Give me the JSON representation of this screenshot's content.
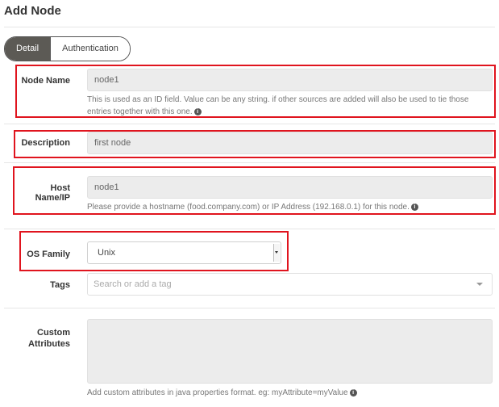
{
  "page": {
    "title": "Add Node"
  },
  "tabs": [
    {
      "label": "Detail",
      "active": true
    },
    {
      "label": "Authentication",
      "active": false
    }
  ],
  "fields": {
    "node_name": {
      "label": "Node Name",
      "value": "node1",
      "help": "This is used as an ID field. Value can be any string. if other sources are added will also be used to tie those entries together with this one."
    },
    "description": {
      "label": "Description",
      "value": "first node"
    },
    "hostname": {
      "label": "Host Name/IP",
      "value": "node1",
      "help": "Please provide a hostname (food.company.com) or IP Address (192.168.0.1) for this node."
    },
    "os_family": {
      "label": "OS Family",
      "selected": "Unix"
    },
    "tags": {
      "label": "Tags",
      "placeholder": "Search or add a tag"
    },
    "custom_attributes": {
      "label_line1": "Custom",
      "label_line2": "Attributes",
      "value": "",
      "help": "Add custom attributes in java properties format. eg: myAttribute=myValue"
    }
  },
  "icons": {
    "info": "info-icon",
    "info_glyph": "i"
  },
  "colors": {
    "highlight": "#e0141e",
    "tab_active": "#5c5a55"
  }
}
